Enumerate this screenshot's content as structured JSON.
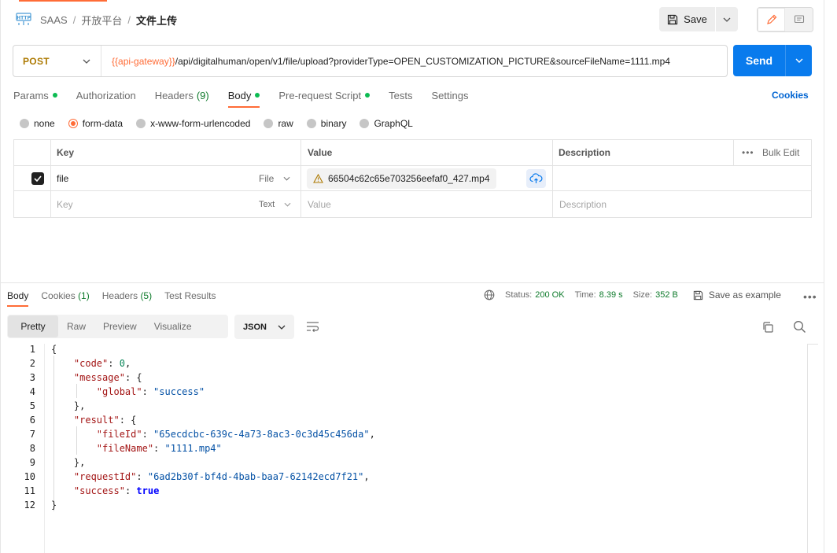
{
  "header": {
    "breadcrumb": [
      "SAAS",
      "开放平台",
      "文件上传"
    ],
    "save_label": "Save"
  },
  "request": {
    "method": "POST",
    "url_variable": "{{api-gateway}}",
    "url_path": "/api/digitalhuman/open/v1/file/upload?providerType=OPEN_CUSTOMIZATION_PICTURE&sourceFileName=1111.mp4",
    "send_label": "Send"
  },
  "request_tabs": [
    {
      "label": "Params",
      "count": "",
      "dot": true
    },
    {
      "label": "Authorization",
      "count": "",
      "dot": false
    },
    {
      "label": "Headers",
      "count": "(9)",
      "dot": false
    },
    {
      "label": "Body",
      "count": "",
      "dot": true,
      "active": true
    },
    {
      "label": "Pre-request Script",
      "count": "",
      "dot": true
    },
    {
      "label": "Tests",
      "count": "",
      "dot": false
    },
    {
      "label": "Settings",
      "count": "",
      "dot": false
    }
  ],
  "cookies_link": "Cookies",
  "body_types": [
    "none",
    "form-data",
    "x-www-form-urlencoded",
    "raw",
    "binary",
    "GraphQL"
  ],
  "body_type_selected": "form-data",
  "form_table": {
    "headers": {
      "key": "Key",
      "value": "Value",
      "description": "Description",
      "bulk_edit": "Bulk Edit"
    },
    "row": {
      "key": "file",
      "type": "File",
      "value": "66504c62c65e703256eefaf0_427.mp4"
    },
    "placeholder": {
      "key": "Key",
      "type": "Text",
      "value": "Value",
      "description": "Description"
    }
  },
  "response_tabs": [
    {
      "label": "Body",
      "count": "",
      "active": true
    },
    {
      "label": "Cookies",
      "count": "(1)"
    },
    {
      "label": "Headers",
      "count": "(5)"
    },
    {
      "label": "Test Results",
      "count": ""
    }
  ],
  "response_meta": {
    "status_label": "Status:",
    "status_value": "200 OK",
    "time_label": "Time:",
    "time_value": "8.39 s",
    "size_label": "Size:",
    "size_value": "352 B",
    "save_example": "Save as example"
  },
  "view_modes": [
    "Pretty",
    "Raw",
    "Preview",
    "Visualize"
  ],
  "view_mode_selected": "Pretty",
  "format": "JSON",
  "code_lines": [
    {
      "n": "1",
      "html": "{"
    },
    {
      "n": "2",
      "html": "    <span class=\"k\">\"code\"</span>: <span class=\"n\">0</span>,"
    },
    {
      "n": "3",
      "html": "    <span class=\"k\">\"message\"</span>: {"
    },
    {
      "n": "4",
      "html": "        <span class=\"k\">\"global\"</span>: <span class=\"s\">\"success\"</span>"
    },
    {
      "n": "5",
      "html": "    },"
    },
    {
      "n": "6",
      "html": "    <span class=\"k\">\"result\"</span>: {"
    },
    {
      "n": "7",
      "html": "        <span class=\"k\">\"fileId\"</span>: <span class=\"s\">\"65ecdcbc-639c-4a73-8ac3-0c3d45c456da\"</span>,"
    },
    {
      "n": "8",
      "html": "        <span class=\"k\">\"fileName\"</span>: <span class=\"s\">\"1111.mp4\"</span>"
    },
    {
      "n": "9",
      "html": "    },"
    },
    {
      "n": "10",
      "html": "    <span class=\"k\">\"requestId\"</span>: <span class=\"s\">\"6ad2b30f-bf4d-4bab-baa7-62142ecd7f21\"</span>,"
    },
    {
      "n": "11",
      "html": "    <span class=\"k\">\"success\"</span>: <span class=\"b\">true</span>"
    },
    {
      "n": "12",
      "html": "}"
    }
  ],
  "colors": {
    "accent": "#ff6c37",
    "send": "#097bed",
    "method": "#ad7a03",
    "ok": "#0f7b2c"
  }
}
